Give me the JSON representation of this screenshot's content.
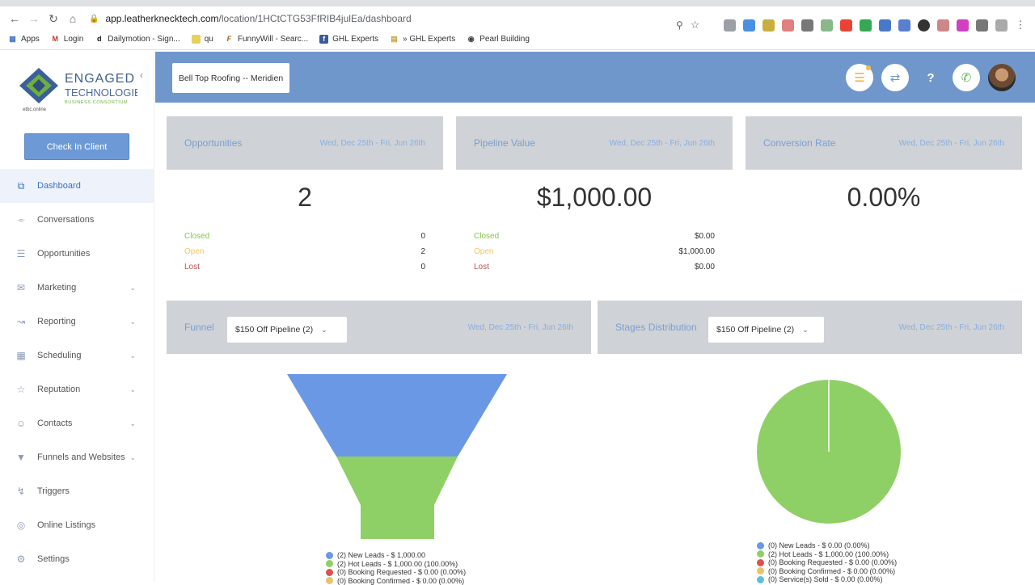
{
  "browser": {
    "url_host": "app.leatherknecktech.com",
    "url_path": "/location/1HCtCTG53FfRIB4julEa/dashboard",
    "bookmarks": [
      {
        "label": "Apps",
        "icon": "apps-grid-icon"
      },
      {
        "label": "Login",
        "icon": "gmail-icon"
      },
      {
        "label": "Dailymotion - Sign...",
        "icon": "dailymotion-icon"
      },
      {
        "label": "qu",
        "icon": "folder-icon"
      },
      {
        "label": "FunnyWill - Searc...",
        "icon": "funnywill-icon"
      },
      {
        "label": "GHL Experts",
        "icon": "facebook-icon"
      },
      {
        "label": "» GHL Experts",
        "icon": "chart-bars-icon"
      },
      {
        "label": "Pearl Building",
        "icon": "globe-icon"
      }
    ]
  },
  "sidebar": {
    "logo_line1": "ENGAGED",
    "logo_line2": "TECHNOLOGIES",
    "logo_line3": "BUSINESS CONSORTIUM",
    "logo_sub": "etbc.online",
    "check_in_label": "Check In Client",
    "items": [
      {
        "label": "Dashboard",
        "icon": "dashboard-icon",
        "active": true,
        "chevron": false
      },
      {
        "label": "Conversations",
        "icon": "chat-icon",
        "active": false,
        "chevron": false
      },
      {
        "label": "Opportunities",
        "icon": "list-icon",
        "active": false,
        "chevron": false
      },
      {
        "label": "Marketing",
        "icon": "mail-icon",
        "active": false,
        "chevron": true
      },
      {
        "label": "Reporting",
        "icon": "line-chart-icon",
        "active": false,
        "chevron": true
      },
      {
        "label": "Scheduling",
        "icon": "calendar-icon",
        "active": false,
        "chevron": true
      },
      {
        "label": "Reputation",
        "icon": "star-icon",
        "active": false,
        "chevron": true
      },
      {
        "label": "Contacts",
        "icon": "person-icon",
        "active": false,
        "chevron": true
      },
      {
        "label": "Funnels and Websites",
        "icon": "filter-icon",
        "active": false,
        "chevron": true
      },
      {
        "label": "Triggers",
        "icon": "bolt-icon",
        "active": false,
        "chevron": false
      },
      {
        "label": "Online Listings",
        "icon": "globe-icon",
        "active": false,
        "chevron": false
      },
      {
        "label": "Settings",
        "icon": "gear-icon",
        "active": false,
        "chevron": false
      }
    ]
  },
  "header": {
    "location_label": "Bell Top Roofing -- Meridien"
  },
  "cards": {
    "opportunities": {
      "title": "Opportunities",
      "date": "Wed, Dec 25th - Fri, Jun 26th",
      "value": "2",
      "rows": [
        {
          "label": "Closed",
          "value": "0"
        },
        {
          "label": "Open",
          "value": "2"
        },
        {
          "label": "Lost",
          "value": "0"
        }
      ]
    },
    "pipeline": {
      "title": "Pipeline Value",
      "date": "Wed, Dec 25th - Fri, Jun 26th",
      "value": "$1,000.00",
      "rows": [
        {
          "label": "Closed",
          "value": "$0.00"
        },
        {
          "label": "Open",
          "value": "$1,000.00"
        },
        {
          "label": "Lost",
          "value": "$0.00"
        }
      ]
    },
    "conversion": {
      "title": "Conversion Rate",
      "date": "Wed, Dec 25th - Fri, Jun 26th",
      "value": "0.00%"
    },
    "funnel": {
      "title": "Funnel",
      "dropdown": "$150 Off Pipeline (2)",
      "date": "Wed, Dec 25th - Fri, Jun 26th",
      "legend": [
        {
          "label": "(2) New Leads - $ 1,000.00",
          "color": "#6b98e4"
        },
        {
          "label": "(2) Hot Leads - $ 1,000.00 (100.00%)",
          "color": "#8fd066"
        },
        {
          "label": "(0) Booking Requested - $ 0.00 (0.00%)",
          "color": "#d9534f"
        },
        {
          "label": "(0) Booking Confirmed - $ 0.00 (0.00%)",
          "color": "#e9c46a"
        }
      ]
    },
    "stages": {
      "title": "Stages Distribution",
      "dropdown": "$150 Off Pipeline (2)",
      "date": "Wed, Dec 25th - Fri, Jun 26th",
      "legend": [
        {
          "label": "(0) New Leads - $ 0.00 (0.00%)",
          "color": "#6b98e4"
        },
        {
          "label": "(2) Hot Leads - $ 1,000.00 (100.00%)",
          "color": "#8fd066"
        },
        {
          "label": "(0) Booking Requested - $ 0.00 (0.00%)",
          "color": "#d9534f"
        },
        {
          "label": "(0) Booking Confirmed - $ 0.00 (0.00%)",
          "color": "#e9c46a"
        },
        {
          "label": "(0) Service(s) Sold - $ 0.00 (0.00%)",
          "color": "#5bc0de"
        }
      ]
    }
  },
  "chart_data": [
    {
      "type": "funnel",
      "categories": [
        "New Leads",
        "Hot Leads",
        "Booking Requested",
        "Booking Confirmed"
      ],
      "values": [
        2,
        2,
        0,
        0
      ]
    },
    {
      "type": "pie",
      "categories": [
        "New Leads",
        "Hot Leads",
        "Booking Requested",
        "Booking Confirmed",
        "Service(s) Sold"
      ],
      "values": [
        0,
        2,
        0,
        0,
        0
      ]
    }
  ]
}
